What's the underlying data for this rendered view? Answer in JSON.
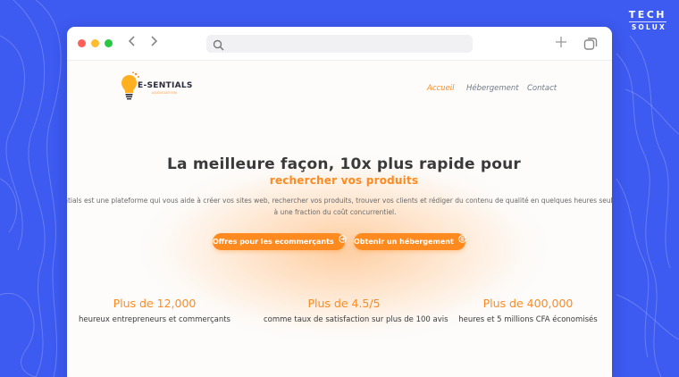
{
  "brand": {
    "line1": "TECH",
    "line2": "SOLUX"
  },
  "browser": {
    "back_icon": "chevron-left-icon",
    "forward_icon": "chevron-right-icon",
    "search_icon": "search-icon",
    "address_value": "",
    "new_tab_icon": "plus-icon",
    "tabs_icon": "tabs-icon"
  },
  "site": {
    "logo_name": "E-SENTIALS",
    "logo_sub": "ASSOCIATION",
    "nav": [
      {
        "label": "Accueil",
        "active": true
      },
      {
        "label": "Hébergement",
        "active": false
      },
      {
        "label": "Contact",
        "active": false
      }
    ],
    "hero": {
      "title": "La meilleure façon, 10x plus rapide pour",
      "subtitle": "rechercher vos produits",
      "description_line1": "-sentials est une plateforme qui vous aide à créer vos sites web, rechercher vos produits, trouver vos clients et rédiger du contenu de qualité en quelques heures seulement",
      "description_line2": "à une fraction du coût concurrentiel."
    },
    "buttons": {
      "offers": "Offres pour les ecommerçants",
      "hosting": "Obtenir un hébergement"
    },
    "stats": [
      {
        "value": "Plus de 12,000",
        "desc": "heureux entrepreneurs et commerçants"
      },
      {
        "value": "Plus de 4.5/5",
        "desc": "comme taux de satisfaction sur plus de 100 avis"
      },
      {
        "value": "Plus de 400,000",
        "desc": "heures et 5 millions CFA économisés"
      }
    ]
  },
  "colors": {
    "background": "#3d5af1",
    "accent": "#ff8a1f",
    "text": "#3a3a3a"
  }
}
